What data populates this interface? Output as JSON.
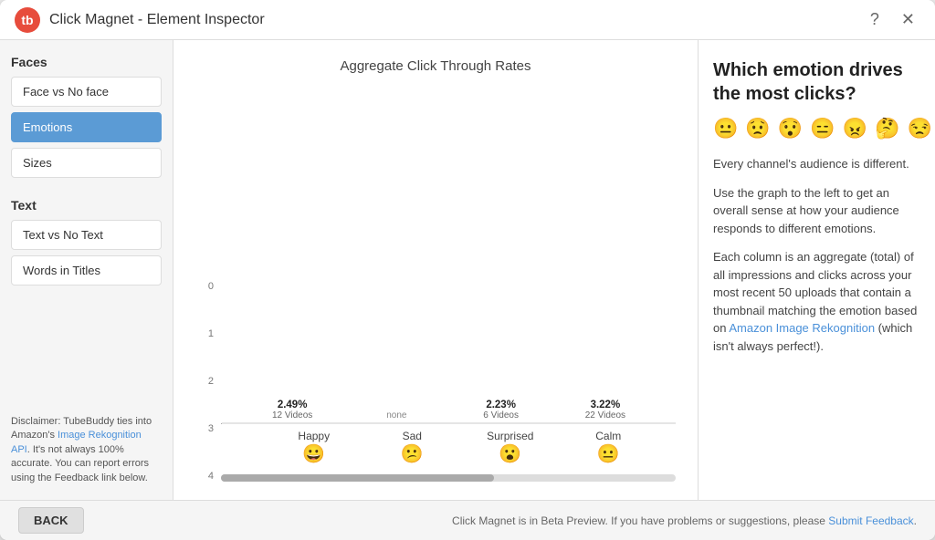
{
  "window": {
    "title": "Click Magnet - Element Inspector",
    "logo": "tb",
    "help_btn": "?",
    "close_btn": "✕"
  },
  "sidebar": {
    "faces_title": "Faces",
    "faces_items": [
      {
        "id": "face-vs-no-face",
        "label": "Face vs No face",
        "active": false
      },
      {
        "id": "emotions",
        "label": "Emotions",
        "active": true
      },
      {
        "id": "sizes",
        "label": "Sizes",
        "active": false
      }
    ],
    "text_title": "Text",
    "text_items": [
      {
        "id": "text-vs-no-text",
        "label": "Text vs No Text",
        "active": false
      },
      {
        "id": "words-in-titles",
        "label": "Words in Titles",
        "active": false
      }
    ],
    "disclaimer": "Disclaimer: TubeBuddy ties into Amazon's ",
    "disclaimer_link": "Image Rekognition API",
    "disclaimer_rest": ". It's not always 100% accurate. You can report errors using the Feedback link below."
  },
  "chart": {
    "title": "Aggregate Click Through Rates",
    "y_labels": [
      "0",
      "1",
      "2",
      "3",
      "4"
    ],
    "bars": [
      {
        "id": "happy",
        "label": "Happy",
        "emoji": "😀",
        "pct": "2.49%",
        "videos": "12 Videos",
        "height_pct": 62,
        "none": false
      },
      {
        "id": "sad",
        "label": "Sad",
        "emoji": "😕",
        "pct": "",
        "videos": "",
        "height_pct": 0,
        "none": true
      },
      {
        "id": "surprised",
        "label": "Surprised",
        "emoji": "😮",
        "pct": "2.23%",
        "videos": "6 Videos",
        "height_pct": 56,
        "none": false
      },
      {
        "id": "calm",
        "label": "Calm",
        "emoji": "😐",
        "pct": "3.22%",
        "videos": "22 Videos",
        "height_pct": 80,
        "none": false
      }
    ]
  },
  "info_panel": {
    "title": "Which emotion drives the most clicks?",
    "emojis": [
      "😐",
      "😟",
      "😯",
      "😑",
      "😠",
      "🤔",
      "😒"
    ],
    "paragraphs": [
      "Every channel's audience is different.",
      "Use the graph to the left to get an overall sense at how your audience responds to different emotions.",
      "Each column is an aggregate (total) of all impressions and clicks across your most recent 50 uploads that contain a thumbnail matching the emotion based on ",
      " (which isn't always perfect!)."
    ],
    "link_text": "Amazon Image Rekognition",
    "link_url": "#"
  },
  "footer": {
    "back_label": "BACK",
    "status_text": "Click Magnet is in Beta Preview. If you have problems or suggestions, please ",
    "feedback_link": "Submit Feedback",
    "feedback_url": "#",
    "status_end": "."
  }
}
